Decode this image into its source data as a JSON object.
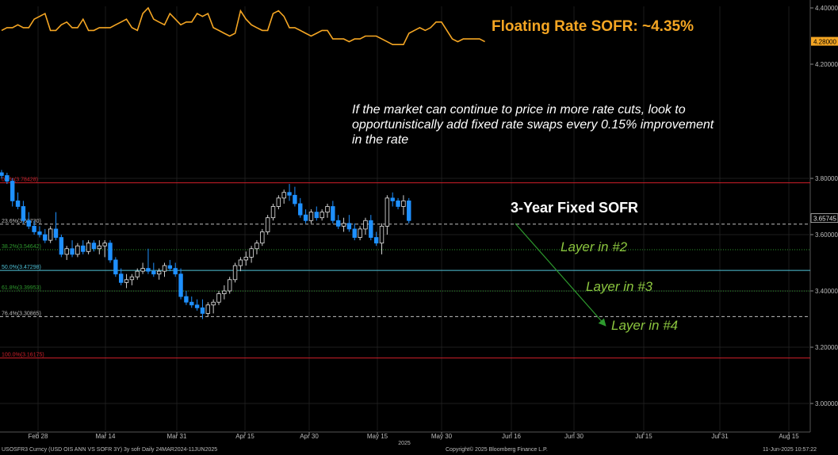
{
  "chart_data": [
    {
      "type": "line",
      "series": [
        {
          "name": "",
          "color": "#f5a623",
          "values": [
            4.32,
            4.33,
            4.33,
            4.34,
            4.33,
            4.33,
            4.36,
            4.37,
            4.38,
            4.32,
            4.32,
            4.34,
            4.35,
            4.33,
            4.33,
            4.36,
            4.32,
            4.32,
            4.33,
            4.33,
            4.33,
            4.34,
            4.35,
            4.36,
            4.33,
            4.32,
            4.38,
            4.4,
            4.36,
            4.35,
            4.34,
            4.38,
            4.36,
            4.34,
            4.35,
            4.35,
            4.38,
            4.37,
            4.38,
            4.33,
            4.32,
            4.31,
            4.3,
            4.31,
            4.39,
            4.36,
            4.34,
            4.33,
            4.32,
            4.32,
            4.38,
            4.39,
            4.37,
            4.33,
            4.33,
            4.32,
            4.31,
            4.3,
            4.31,
            4.32,
            4.32,
            4.29,
            4.29,
            4.29,
            4.28,
            4.29,
            4.29,
            4.3,
            4.3,
            4.3,
            4.29,
            4.28,
            4.27,
            4.27,
            4.27,
            4.31,
            4.32,
            4.33,
            4.32,
            4.33,
            4.35,
            4.35,
            4.32,
            4.29,
            4.28,
            4.29,
            4.29,
            4.29,
            4.29,
            4.28
          ]
        }
      ],
      "last_value_label": "4.28000",
      "ylim": [
        4.2,
        4.4
      ],
      "y_ticks": [
        "4.40000",
        "4.20000"
      ],
      "title": "Floating Rate SOFR: ~4.35%"
    },
    {
      "type": "candlestick",
      "title": "3-Year Fixed SOFR",
      "ylim": [
        3.0,
        3.84
      ],
      "y_ticks": [
        "3.80000",
        "3.60000",
        "3.40000",
        "3.20000",
        "3.00000"
      ],
      "y_tick_positions": [
        3.8,
        3.6,
        3.4,
        3.2,
        3.0
      ],
      "last_value_label": "3.65745",
      "x_tick_labels": [
        "Feb 28",
        "Mar 14",
        "Mar 31",
        "Apr 15",
        "Apr 30",
        "May 15",
        "May 30",
        "Jun 16",
        "Jun 30",
        "Jul 15",
        "Jul 31",
        "Aug 15"
      ],
      "x_year_label": "2025",
      "fib_levels": [
        {
          "label": "0.0%(3.78428)",
          "value": 3.78428,
          "color": "#d11f2a",
          "style": "solid"
        },
        {
          "label": "23.6%(3.63730)",
          "value": 3.6373,
          "color": "#bdbdbd",
          "style": "dashed"
        },
        {
          "label": "38.2%(3.54642)",
          "value": 3.54642,
          "color": "#2e9a2e",
          "style": "dotted"
        },
        {
          "label": "50.0%(3.47298)",
          "value": 3.47298,
          "color": "#4fc3d9",
          "style": "solid"
        },
        {
          "label": "61.8%(3.39953)",
          "value": 3.39953,
          "color": "#2e9a2e",
          "style": "dotted"
        },
        {
          "label": "76.4%(3.30865)",
          "value": 3.30865,
          "color": "#bdbdbd",
          "style": "dashed"
        },
        {
          "label": "100.0%(3.16175)",
          "value": 3.16175,
          "color": "#d11f2a",
          "style": "solid"
        }
      ],
      "candles": [
        [
          3.82,
          3.83,
          3.8,
          3.81
        ],
        [
          3.81,
          3.82,
          3.78,
          3.79
        ],
        [
          3.79,
          3.8,
          3.7,
          3.72
        ],
        [
          3.72,
          3.75,
          3.69,
          3.7
        ],
        [
          3.7,
          3.72,
          3.64,
          3.65
        ],
        [
          3.65,
          3.68,
          3.62,
          3.63
        ],
        [
          3.63,
          3.65,
          3.6,
          3.61
        ],
        [
          3.61,
          3.63,
          3.59,
          3.6
        ],
        [
          3.6,
          3.62,
          3.57,
          3.58
        ],
        [
          3.58,
          3.63,
          3.57,
          3.62
        ],
        [
          3.62,
          3.68,
          3.58,
          3.59
        ],
        [
          3.59,
          3.6,
          3.52,
          3.53
        ],
        [
          3.53,
          3.56,
          3.51,
          3.55
        ],
        [
          3.55,
          3.58,
          3.52,
          3.53
        ],
        [
          3.53,
          3.57,
          3.52,
          3.56
        ],
        [
          3.56,
          3.58,
          3.53,
          3.54
        ],
        [
          3.54,
          3.58,
          3.53,
          3.57
        ],
        [
          3.57,
          3.58,
          3.54,
          3.55
        ],
        [
          3.55,
          3.58,
          3.53,
          3.56
        ],
        [
          3.56,
          3.58,
          3.52,
          3.57
        ],
        [
          3.57,
          3.58,
          3.5,
          3.51
        ],
        [
          3.51,
          3.52,
          3.45,
          3.46
        ],
        [
          3.46,
          3.48,
          3.42,
          3.43
        ],
        [
          3.43,
          3.46,
          3.41,
          3.44
        ],
        [
          3.44,
          3.46,
          3.42,
          3.45
        ],
        [
          3.45,
          3.48,
          3.44,
          3.47
        ],
        [
          3.47,
          3.5,
          3.46,
          3.48
        ],
        [
          3.48,
          3.55,
          3.46,
          3.47
        ],
        [
          3.47,
          3.5,
          3.45,
          3.46
        ],
        [
          3.46,
          3.48,
          3.44,
          3.47
        ],
        [
          3.47,
          3.5,
          3.45,
          3.49
        ],
        [
          3.49,
          3.51,
          3.47,
          3.48
        ],
        [
          3.48,
          3.5,
          3.45,
          3.46
        ],
        [
          3.46,
          3.48,
          3.37,
          3.38
        ],
        [
          3.38,
          3.4,
          3.35,
          3.36
        ],
        [
          3.36,
          3.38,
          3.34,
          3.35
        ],
        [
          3.35,
          3.37,
          3.33,
          3.34
        ],
        [
          3.34,
          3.37,
          3.3,
          3.32
        ],
        [
          3.32,
          3.36,
          3.31,
          3.35
        ],
        [
          3.35,
          3.37,
          3.32,
          3.36
        ],
        [
          3.36,
          3.4,
          3.35,
          3.39
        ],
        [
          3.39,
          3.42,
          3.37,
          3.4
        ],
        [
          3.4,
          3.45,
          3.39,
          3.44
        ],
        [
          3.44,
          3.5,
          3.43,
          3.49
        ],
        [
          3.49,
          3.52,
          3.47,
          3.51
        ],
        [
          3.51,
          3.54,
          3.49,
          3.52
        ],
        [
          3.52,
          3.56,
          3.5,
          3.55
        ],
        [
          3.55,
          3.58,
          3.53,
          3.57
        ],
        [
          3.57,
          3.62,
          3.56,
          3.61
        ],
        [
          3.61,
          3.67,
          3.6,
          3.66
        ],
        [
          3.66,
          3.71,
          3.65,
          3.7
        ],
        [
          3.7,
          3.74,
          3.69,
          3.73
        ],
        [
          3.73,
          3.76,
          3.71,
          3.75
        ],
        [
          3.75,
          3.78,
          3.72,
          3.74
        ],
        [
          3.74,
          3.77,
          3.7,
          3.71
        ],
        [
          3.71,
          3.73,
          3.66,
          3.67
        ],
        [
          3.67,
          3.69,
          3.64,
          3.65
        ],
        [
          3.65,
          3.69,
          3.64,
          3.68
        ],
        [
          3.68,
          3.7,
          3.65,
          3.66
        ],
        [
          3.66,
          3.69,
          3.65,
          3.68
        ],
        [
          3.68,
          3.71,
          3.66,
          3.7
        ],
        [
          3.7,
          3.72,
          3.64,
          3.65
        ],
        [
          3.65,
          3.67,
          3.62,
          3.63
        ],
        [
          3.63,
          3.66,
          3.61,
          3.64
        ],
        [
          3.64,
          3.67,
          3.61,
          3.62
        ],
        [
          3.62,
          3.64,
          3.58,
          3.59
        ],
        [
          3.59,
          3.63,
          3.58,
          3.62
        ],
        [
          3.62,
          3.66,
          3.6,
          3.65
        ],
        [
          3.65,
          3.67,
          3.58,
          3.59
        ],
        [
          3.59,
          3.61,
          3.56,
          3.57
        ],
        [
          3.57,
          3.64,
          3.53,
          3.63
        ],
        [
          3.63,
          3.74,
          3.6,
          3.73
        ],
        [
          3.73,
          3.75,
          3.7,
          3.72
        ],
        [
          3.72,
          3.73,
          3.69,
          3.7
        ],
        [
          3.7,
          3.74,
          3.67,
          3.72
        ],
        [
          3.72,
          3.73,
          3.64,
          3.65
        ]
      ]
    }
  ],
  "annotations": {
    "note": "If the market can continue to price in more rate cuts, look to opportunistically add fixed rate swaps every 0.15% improvement in the rate",
    "layer2": "Layer in #2",
    "layer3": "Layer in #3",
    "layer4": "Layer in #4"
  },
  "footer": {
    "left": "USOSFR3 Curncy (USD OIS  ANN VS SOFR 3Y) 3y sofr  Daily 24MAR2024-11JUN2025",
    "middle": "Copyright© 2025 Bloomberg Finance L.P.",
    "right": "11-Jun-2025 10:57:22"
  }
}
